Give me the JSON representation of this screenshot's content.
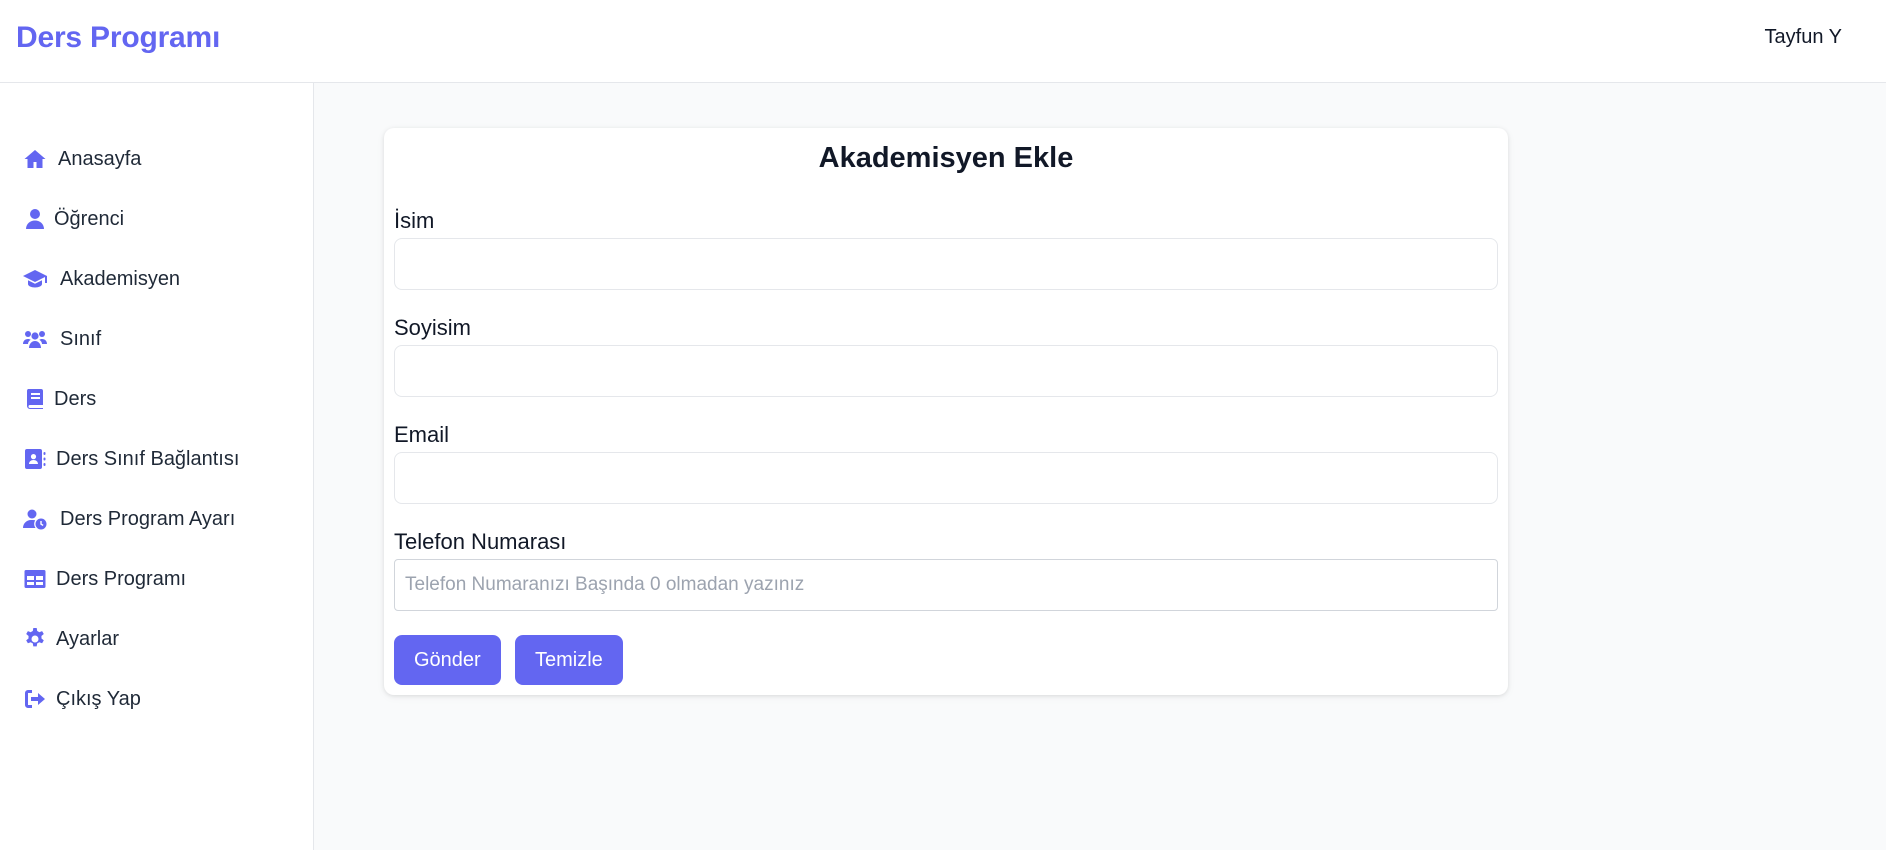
{
  "header": {
    "brand": "Ders Programı",
    "user_name": "Tayfun Y"
  },
  "sidebar": {
    "items": [
      {
        "label": "Anasayfa",
        "icon": "home-icon"
      },
      {
        "label": "Öğrenci",
        "icon": "user-icon"
      },
      {
        "label": "Akademisyen",
        "icon": "graduation-cap-icon"
      },
      {
        "label": "Sınıf",
        "icon": "users-icon"
      },
      {
        "label": "Ders",
        "icon": "book-icon"
      },
      {
        "label": "Ders Sınıf Bağlantısı",
        "icon": "address-book-icon"
      },
      {
        "label": "Ders Program Ayarı",
        "icon": "user-clock-icon"
      },
      {
        "label": "Ders Programı",
        "icon": "table-icon"
      },
      {
        "label": "Ayarlar",
        "icon": "gear-icon"
      },
      {
        "label": "Çıkış Yap",
        "icon": "sign-out-icon"
      }
    ]
  },
  "form": {
    "title": "Akademisyen Ekle",
    "fields": [
      {
        "label": "İsim",
        "value": "",
        "placeholder": ""
      },
      {
        "label": "Soyisim",
        "value": "",
        "placeholder": ""
      },
      {
        "label": "Email",
        "value": "",
        "placeholder": ""
      },
      {
        "label": "Telefon Numarası",
        "value": "",
        "placeholder": "Telefon Numaranızı Başında 0 olmadan yazınız"
      }
    ],
    "submit_label": "Gönder",
    "clear_label": "Temizle"
  },
  "colors": {
    "accent": "#6366f1",
    "page_background": "#f9fafb"
  }
}
